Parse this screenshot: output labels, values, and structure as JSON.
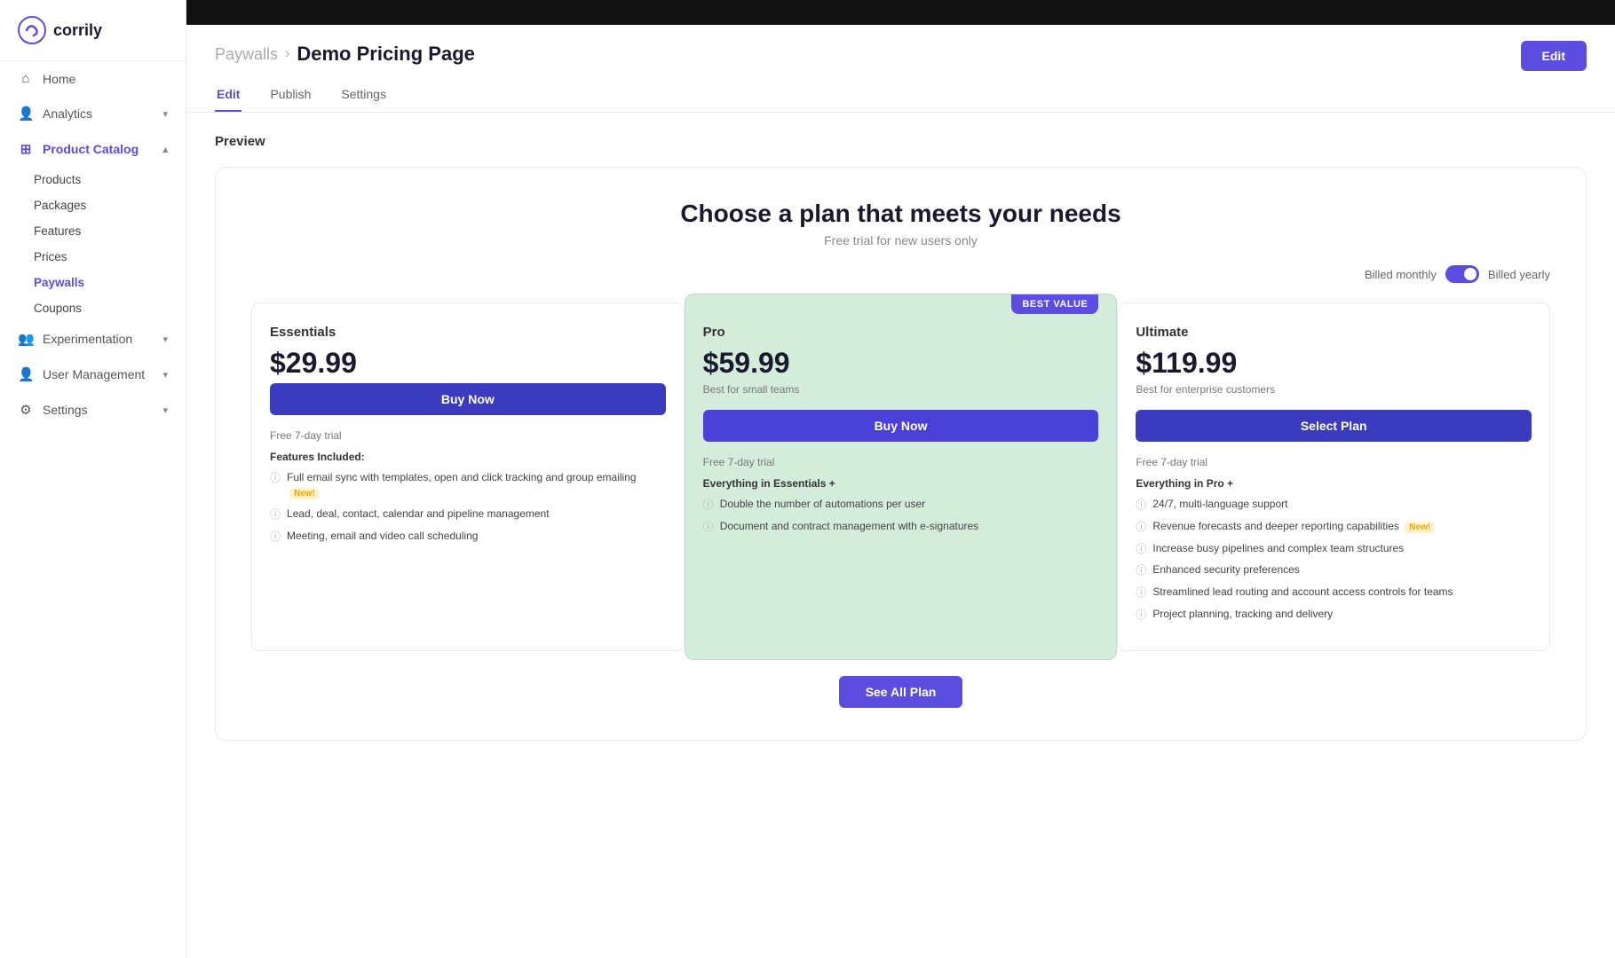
{
  "logo": {
    "text": "corrily"
  },
  "sidebar": {
    "home": "Home",
    "analytics": "Analytics",
    "product_catalog": "Product Catalog",
    "sub_items": [
      "Products",
      "Packages",
      "Features",
      "Prices",
      "Paywalls",
      "Coupons"
    ],
    "experimentation": "Experimentation",
    "user_management": "User Management",
    "settings": "Settings"
  },
  "header": {
    "breadcrumb_parent": "Paywalls",
    "breadcrumb_sep": "›",
    "breadcrumb_current": "Demo Pricing Page",
    "edit_btn": "Edit"
  },
  "tabs": [
    "Edit",
    "Publish",
    "Settings"
  ],
  "active_tab": "Edit",
  "preview": {
    "label": "Preview",
    "headline": "Choose a plan that meets your needs",
    "subline": "Free trial for new users only",
    "billing_monthly": "Billed monthly",
    "billing_yearly": "Billed yearly",
    "plans": [
      {
        "name": "Essentials",
        "price": "$29.99",
        "price_sub": "",
        "btn": "Buy Now",
        "free_trial": "Free 7-day trial",
        "type": "essentials",
        "features_label": "Features Included:",
        "features": [
          "Full email sync with templates, open and click tracking and group emailing",
          "Lead, deal, contact, calendar and pipeline management",
          "Meeting, email and video call scheduling"
        ],
        "feature_new": [
          true,
          false,
          false
        ]
      },
      {
        "name": "Pro",
        "price": "$59.99",
        "price_sub": "Best for small teams",
        "btn": "Buy Now",
        "free_trial": "Free 7-day trial",
        "type": "pro",
        "best_value": "BEST VALUE",
        "features_label": "Everything in Essentials +",
        "features": [
          "Double the number of automations per user",
          "Document and contract management with e-signatures"
        ],
        "feature_new": [
          false,
          false
        ]
      },
      {
        "name": "Ultimate",
        "price": "$119.99",
        "price_sub": "Best for enterprise customers",
        "btn": "Select Plan",
        "free_trial": "Free 7-day trial",
        "type": "ultimate",
        "features_label": "Everything in Pro +",
        "features": [
          "24/7, multi-language support",
          "Revenue forecasts and deeper reporting capabilities",
          "Increase busy pipelines and complex team structures",
          "Enhanced security preferences",
          "Streamlined lead routing and account access controls for teams",
          "Project planning, tracking and delivery"
        ],
        "feature_new": [
          false,
          true,
          false,
          false,
          false,
          false
        ]
      }
    ],
    "see_all_btn": "See All Plan"
  }
}
